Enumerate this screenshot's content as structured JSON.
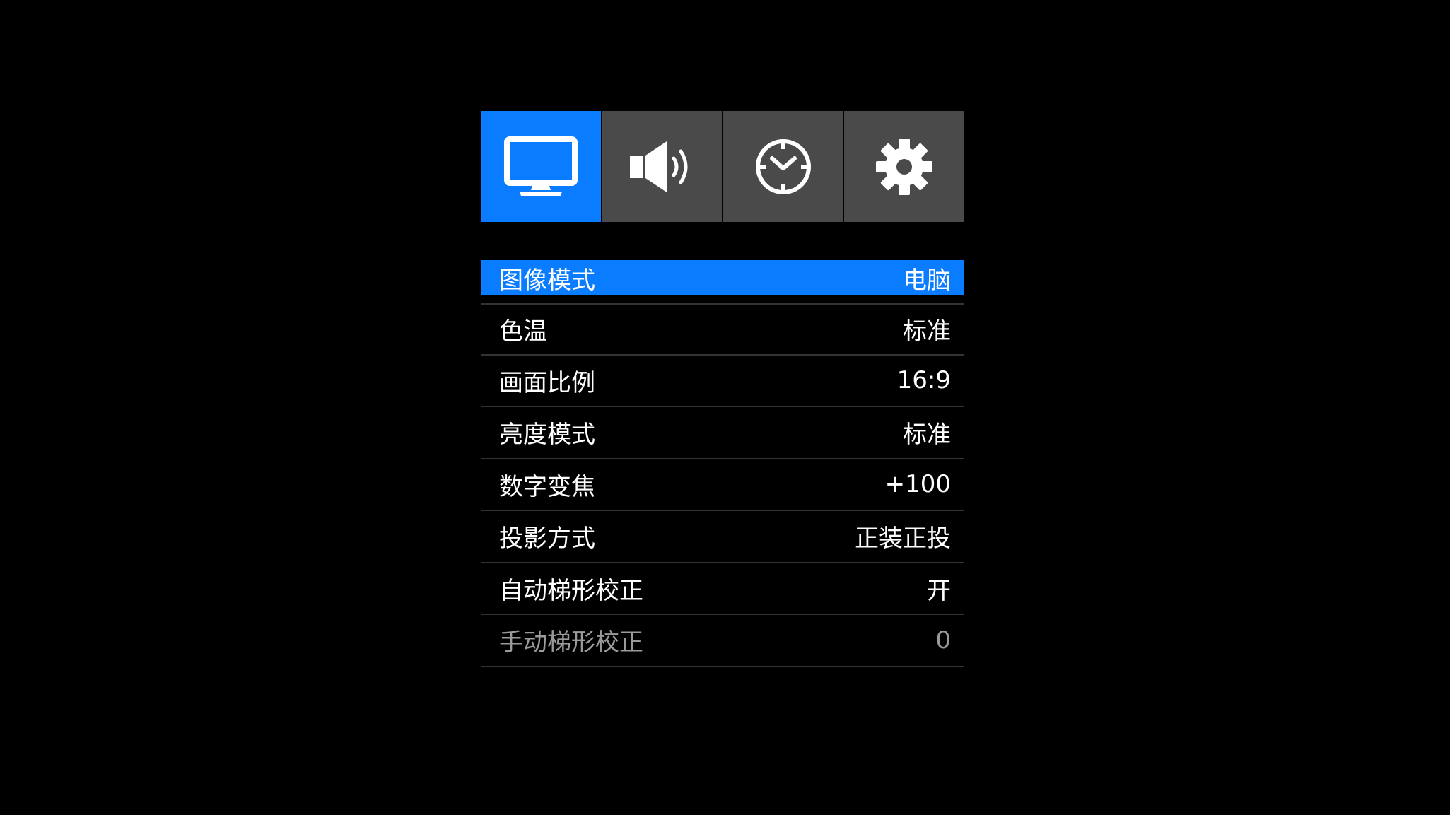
{
  "tabs": [
    {
      "name": "picture",
      "icon": "monitor-icon",
      "active": true
    },
    {
      "name": "sound",
      "icon": "speaker-icon",
      "active": false
    },
    {
      "name": "timer",
      "icon": "clock-icon",
      "active": false
    },
    {
      "name": "settings",
      "icon": "gear-icon",
      "active": false
    }
  ],
  "menu": {
    "items": [
      {
        "label": "图像模式",
        "value": "电脑"
      },
      {
        "label": "色温",
        "value": "标准"
      },
      {
        "label": "画面比例",
        "value": "16:9"
      },
      {
        "label": "亮度模式",
        "value": "标准"
      },
      {
        "label": "数字变焦",
        "value": "+100"
      },
      {
        "label": "投影方式",
        "value": "正装正投"
      },
      {
        "label": "自动梯形校正",
        "value": "开"
      },
      {
        "label": "手动梯形校正",
        "value": "0"
      }
    ],
    "selected_index": 0,
    "disabled_index": 7
  },
  "colors": {
    "accent": "#0a7cff",
    "tab_inactive": "#4a4a4a",
    "background": "#000000",
    "divider": "#333333",
    "disabled_text": "#9a9a9a"
  }
}
